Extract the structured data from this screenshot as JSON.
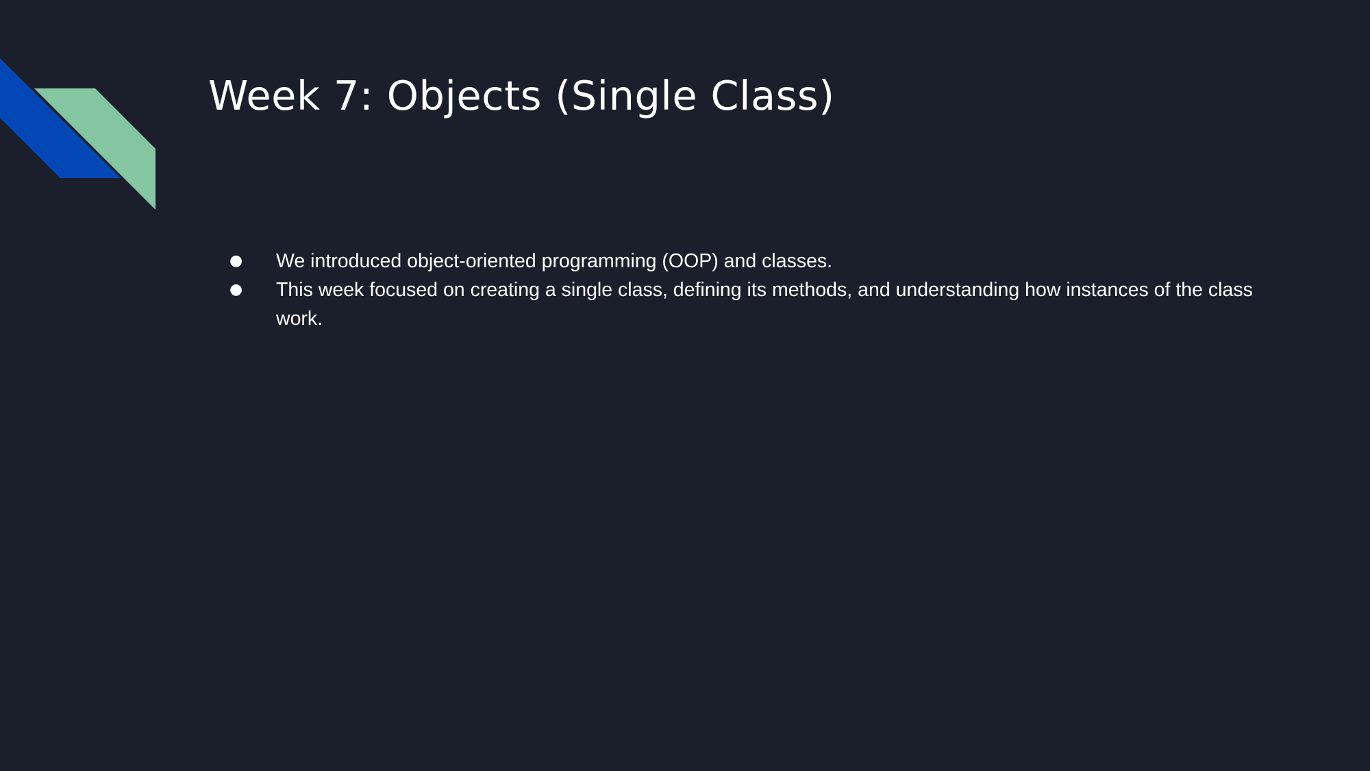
{
  "slide": {
    "title": "Week 7: Objects (Single Class)",
    "bullets": [
      {
        "text": "We introduced object-oriented programming (OOP) and classes."
      },
      {
        "text": "This week focused on creating a single class, defining its methods, and understanding how instances of the class work."
      }
    ],
    "bullet_icon": "●"
  },
  "colors": {
    "background": "#1b1f2b",
    "text": "#ffffff",
    "accent_blue": "#0346b5",
    "accent_green": "#83c6a1"
  }
}
